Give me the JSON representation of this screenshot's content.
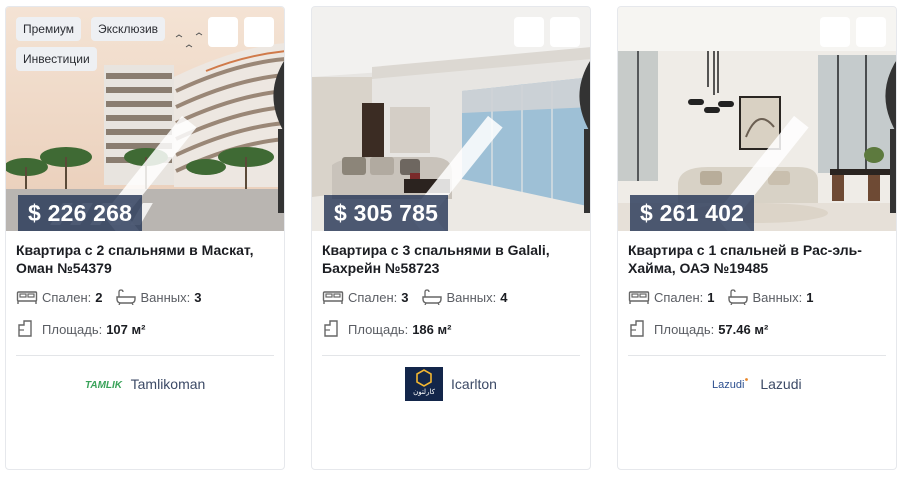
{
  "cards": [
    {
      "tags": [
        "Премиум",
        "Эксклюзив",
        "Инвестиции"
      ],
      "price": "$ 226 268",
      "title": "Квартира с 2 спальнями в Маскат, Оман №54379",
      "bedrooms_label": "Спален:",
      "bedrooms": "2",
      "bathrooms_label": "Ванных:",
      "bathrooms": "3",
      "area_label": "Площадь:",
      "area": "107 м²",
      "agency_logo_text": "TAMLIK",
      "agency_name": "Tamlikoman"
    },
    {
      "tags": [],
      "price": "$ 305 785",
      "title": "Квартира с 3 спальнями в Galali, Бахрейн №58723",
      "bedrooms_label": "Спален:",
      "bedrooms": "3",
      "bathrooms_label": "Ванных:",
      "bathrooms": "4",
      "area_label": "Площадь:",
      "area": "186 м²",
      "agency_logo_text": "كارلتون",
      "agency_name": "Icarlton"
    },
    {
      "tags": [],
      "price": "$ 261 402",
      "title": "Квартира с 1 спальней в Рас-эль-Хайма, ОАЭ №19485",
      "bedrooms_label": "Спален:",
      "bedrooms": "1",
      "bathrooms_label": "Ванных:",
      "bathrooms": "1",
      "area_label": "Площадь:",
      "area": "57.46 м²",
      "agency_logo_text": "Lazudi",
      "agency_name": "Lazudi"
    }
  ],
  "colors": {
    "price_bg": "#283858",
    "tag_bg": "#eef0f3",
    "agency_text": "#3c4a66",
    "tamlik_green": "#3aa35a",
    "icarlton_navy": "#13264a",
    "lazudi_blue": "#2c4f8f",
    "lazudi_orange": "#e8862a"
  },
  "icons": [
    "bar-chart-icon",
    "heart-icon",
    "chevron-left-icon",
    "chevron-right-icon",
    "bed-icon",
    "bath-icon",
    "area-icon"
  ]
}
